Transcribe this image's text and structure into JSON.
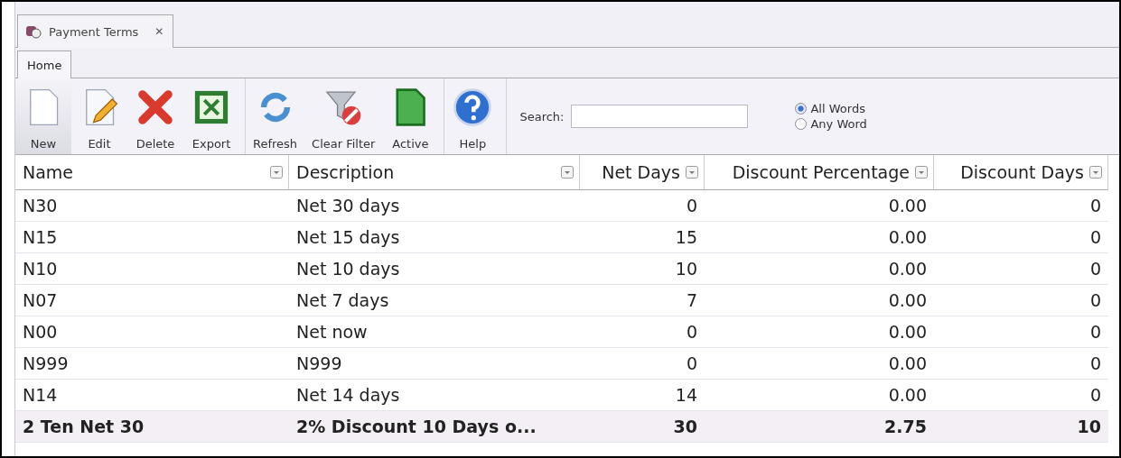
{
  "document_tab": {
    "title": "Payment Terms",
    "close": "✕"
  },
  "ribbon_tabs": [
    {
      "label": "Home",
      "selected": true
    }
  ],
  "toolbar": {
    "groups": [
      [
        {
          "label": "New",
          "selected": true
        },
        {
          "label": "Edit",
          "selected": false
        },
        {
          "label": "Delete",
          "selected": false
        },
        {
          "label": "Export",
          "selected": false
        }
      ],
      [
        {
          "label": "Refresh",
          "selected": false
        },
        {
          "label": "Clear Filter",
          "selected": false
        },
        {
          "label": "Active",
          "selected": false
        }
      ],
      [
        {
          "label": "Help",
          "selected": false
        }
      ]
    ]
  },
  "search": {
    "label": "Search:"
  },
  "search_mode": [
    {
      "label": "All Words",
      "selected": true
    },
    {
      "label": "Any Word",
      "selected": false
    }
  ],
  "table": {
    "columns": [
      {
        "label": "Name"
      },
      {
        "label": "Description"
      },
      {
        "label": "Net Days"
      },
      {
        "label": "Discount Percentage"
      },
      {
        "label": "Discount Days"
      }
    ],
    "rows": [
      {
        "cells": [
          "N30",
          "Net 30 days",
          "0",
          "0.00",
          "0"
        ],
        "selected": false
      },
      {
        "cells": [
          "N15",
          "Net 15 days",
          "15",
          "0.00",
          "0"
        ],
        "selected": false
      },
      {
        "cells": [
          "N10",
          "Net 10 days",
          "10",
          "0.00",
          "0"
        ],
        "selected": false
      },
      {
        "cells": [
          "N07",
          "Net 7 days",
          "7",
          "0.00",
          "0"
        ],
        "selected": false
      },
      {
        "cells": [
          "N00",
          "Net now",
          "0",
          "0.00",
          "0"
        ],
        "selected": false
      },
      {
        "cells": [
          "N999",
          "N999",
          "0",
          "0.00",
          "0"
        ],
        "selected": false
      },
      {
        "cells": [
          "N14",
          "Net 14 days",
          "14",
          "0.00",
          "0"
        ],
        "selected": false
      },
      {
        "cells": [
          "2 Ten Net 30",
          "2% Discount 10 Days o...",
          "30",
          "2.75",
          "10"
        ],
        "selected": true
      }
    ]
  }
}
